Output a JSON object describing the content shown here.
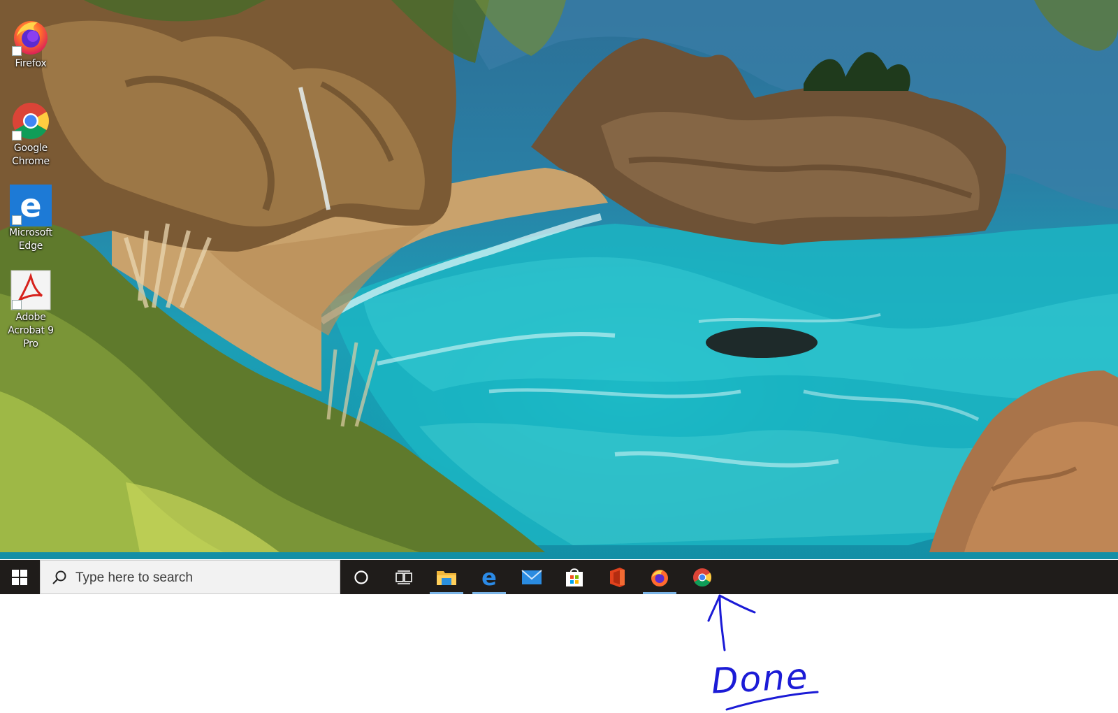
{
  "desktop": {
    "icons": [
      {
        "label": "Firefox",
        "icon": "firefox-icon"
      },
      {
        "label": "Google Chrome",
        "icon": "chrome-icon"
      },
      {
        "label": "Microsoft Edge",
        "icon": "edge-icon"
      },
      {
        "label": "Adobe Acrobat 9 Pro",
        "icon": "acrobat-icon"
      }
    ]
  },
  "taskbar": {
    "search": {
      "placeholder": "Type here to search"
    },
    "pinned": [
      {
        "name": "Cortana",
        "icon": "cortana-icon",
        "running": false
      },
      {
        "name": "Task View",
        "icon": "task-view-icon",
        "running": false
      },
      {
        "name": "File Explorer",
        "icon": "file-explorer-icon",
        "running": true
      },
      {
        "name": "Microsoft Edge",
        "icon": "edge-icon",
        "running": true
      },
      {
        "name": "Mail",
        "icon": "mail-icon",
        "running": false
      },
      {
        "name": "Microsoft Store",
        "icon": "store-icon",
        "running": false
      },
      {
        "name": "Office",
        "icon": "office-icon",
        "running": false
      },
      {
        "name": "Firefox",
        "icon": "firefox-icon",
        "running": true
      },
      {
        "name": "Google Chrome",
        "icon": "chrome-icon",
        "running": false
      }
    ]
  },
  "annotation": {
    "text": "Done",
    "color": "#1b1bd6"
  },
  "colors": {
    "taskbar": "#1f1c1a",
    "running_indicator": "#7bb4e6"
  }
}
